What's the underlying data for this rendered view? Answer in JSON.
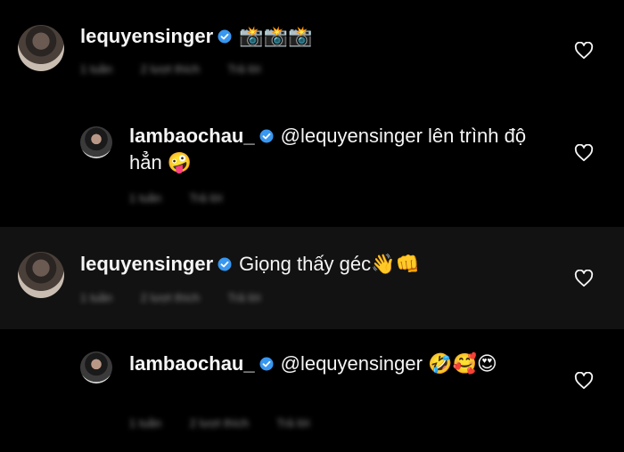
{
  "comments": [
    {
      "username": "lequyensinger",
      "text": "",
      "emoji": "📸📸📸",
      "meta": {
        "time": "1 tuần",
        "likes": "2 lượt thích",
        "reply": "Trả lời"
      }
    },
    {
      "username": "lambaochau_",
      "text": "@lequyensinger lên trình độ hẳn",
      "emoji": "🤪",
      "meta": {
        "time": "1 tuần",
        "reply": "Trả lời"
      }
    },
    {
      "username": "lequyensinger",
      "text": "Giọng thấy géc",
      "emoji": "👋👊",
      "meta": {
        "time": "1 tuần",
        "likes": "2 lượt thích",
        "reply": "Trả lời"
      }
    },
    {
      "username": "lambaochau_",
      "text": "@lequyensinger",
      "emoji": "🤣🥰😍",
      "meta": {
        "time": "1 tuần",
        "likes": "2 lượt thích",
        "reply": "Trả lời"
      }
    }
  ],
  "colors": {
    "background": "#000000",
    "highlight_row": "#121212",
    "verified": "#3897f0",
    "text": "#f5f5f5",
    "meta": "#8e8e8e"
  },
  "icons": {
    "verified": "verified-badge-icon",
    "like": "heart-icon"
  }
}
